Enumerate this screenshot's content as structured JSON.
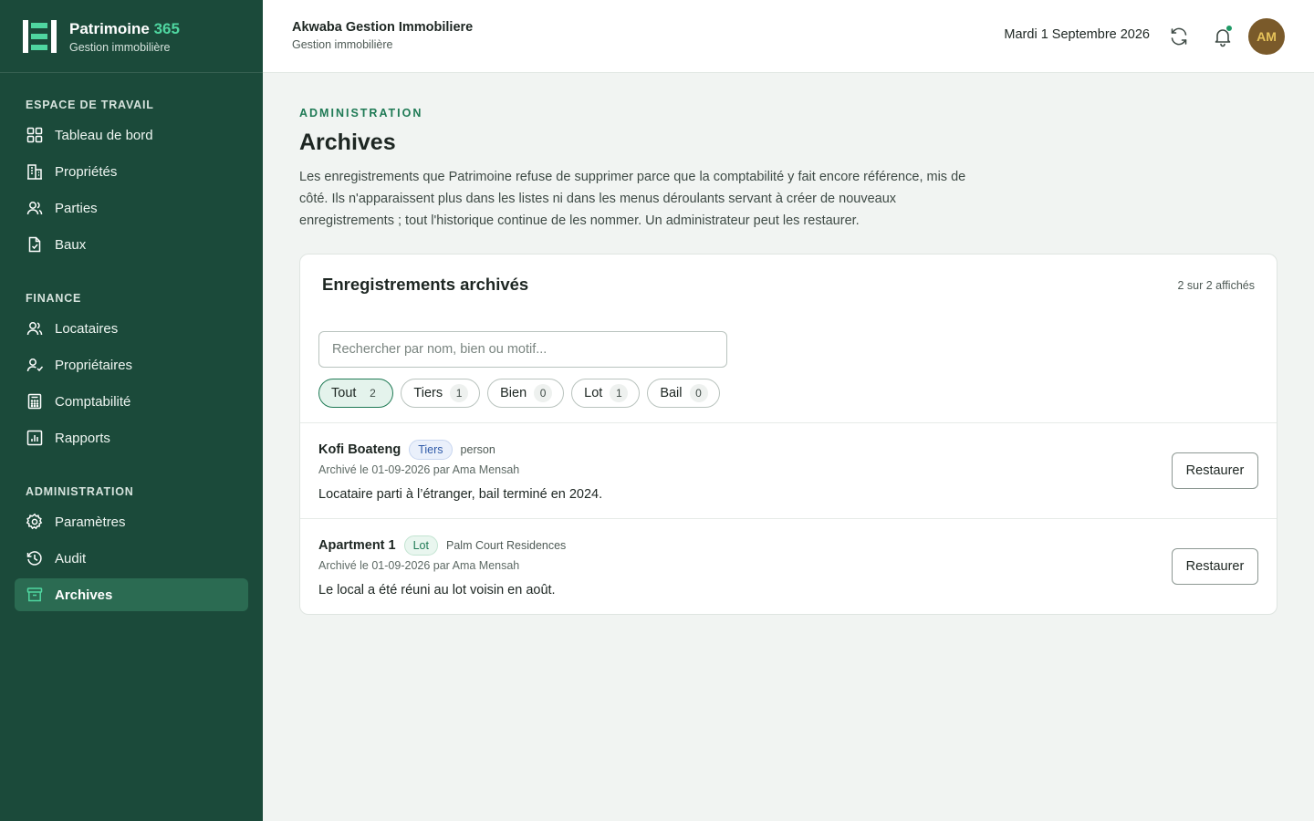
{
  "brand": {
    "name": "Patrimoine",
    "name_accent": "365",
    "subtitle": "Gestion immobilière"
  },
  "sidebar": {
    "sections": [
      {
        "heading": "ESPACE DE TRAVAIL",
        "items": [
          {
            "label": "Tableau de bord",
            "icon": "dashboard-icon"
          },
          {
            "label": "Propriétés",
            "icon": "building-icon"
          },
          {
            "label": "Parties",
            "icon": "users-icon"
          },
          {
            "label": "Baux",
            "icon": "document-icon"
          }
        ]
      },
      {
        "heading": "FINANCE",
        "items": [
          {
            "label": "Locataires",
            "icon": "users-icon"
          },
          {
            "label": "Propriétaires",
            "icon": "user-check-icon"
          },
          {
            "label": "Comptabilité",
            "icon": "calculator-icon"
          },
          {
            "label": "Rapports",
            "icon": "bar-chart-icon"
          }
        ]
      },
      {
        "heading": "ADMINISTRATION",
        "items": [
          {
            "label": "Paramètres",
            "icon": "gear-icon"
          },
          {
            "label": "Audit",
            "icon": "history-icon"
          },
          {
            "label": "Archives",
            "icon": "archive-icon",
            "active": true
          }
        ]
      }
    ]
  },
  "header": {
    "org_name": "Akwaba Gestion Immobiliere",
    "org_subtitle": "Gestion immobilière",
    "date": "Mardi 1 Septembre 2026",
    "avatar_initials": "AM"
  },
  "main": {
    "eyebrow": "ADMINISTRATION",
    "title": "Archives",
    "description": "Les enregistrements que Patrimoine refuse de supprimer parce que la comptabilité y fait encore référence, mis de côté. Ils n'apparaissent plus dans les listes ni dans les menus déroulants servant à créer de nouveaux enregistrements ; tout l'historique continue de les nommer. Un administrateur peut les restaurer.",
    "card": {
      "title": "Enregistrements archivés",
      "count_text": "2 sur 2 affichés",
      "search_placeholder": "Rechercher par nom, bien ou motif...",
      "filters": [
        {
          "label": "Tout",
          "count": "2",
          "active": true
        },
        {
          "label": "Tiers",
          "count": "1"
        },
        {
          "label": "Bien",
          "count": "0"
        },
        {
          "label": "Lot",
          "count": "1"
        },
        {
          "label": "Bail",
          "count": "0"
        }
      ],
      "rows": [
        {
          "name": "Kofi Boateng",
          "badge": "Tiers",
          "extra": "person",
          "meta": "Archivé le 01-09-2026 par Ama Mensah",
          "reason": "Locataire parti à l’étranger, bail terminé en 2024.",
          "action": "Restaurer"
        },
        {
          "name": "Apartment 1",
          "badge": "Lot",
          "extra": "Palm Court Residences",
          "meta": "Archivé le 01-09-2026 par Ama Mensah",
          "reason": "Le local a été réuni au lot voisin en août.",
          "action": "Restaurer"
        }
      ]
    }
  },
  "colors": {
    "sidebar_bg": "#1b4a3a",
    "accent": "#1f7a55",
    "brand_accent": "#4fd6a0",
    "avatar_bg": "#7a5a2a"
  }
}
